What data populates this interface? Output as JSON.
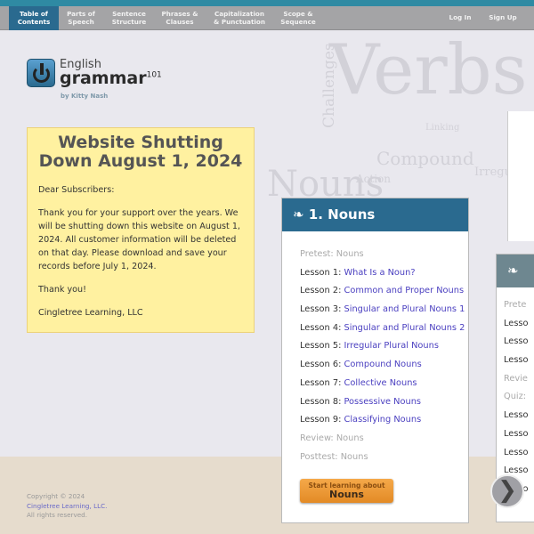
{
  "nav": {
    "tabs": [
      {
        "label": "Table of Contents",
        "active": true
      },
      {
        "label": "Parts of Speech"
      },
      {
        "label": "Sentence Structure"
      },
      {
        "label": "Phrases & Clauses"
      },
      {
        "label": "Capitalization & Punctuation"
      },
      {
        "label": "Scope & Sequence"
      }
    ],
    "login": "Log In",
    "signup": "Sign Up"
  },
  "logo": {
    "line1": "English",
    "line2": "grammar",
    "sup": "101",
    "byline": "by Kitty Nash",
    "icon": "power-icon"
  },
  "notice": {
    "title": "Website Shutting Down August 1, 2024",
    "greeting": "Dear Subscribers:",
    "body": "Thank you for your support over the years. We will be shutting down this website on August 1, 2024. All customer information will be deleted on that day. Please download and save your records before July 1, 2024.",
    "thanks": "Thank you!",
    "signature": "Cingletree Learning, LLC"
  },
  "card1": {
    "title": "1. Nouns",
    "icon": "swirl-icon",
    "items": [
      {
        "prefix": "Pretest: Nouns",
        "dim": true
      },
      {
        "prefix": "Lesson 1: ",
        "link": "What Is a Noun?"
      },
      {
        "prefix": "Lesson 2: ",
        "link": "Common and Proper Nouns"
      },
      {
        "prefix": "Lesson 3: ",
        "link": "Singular and Plural Nouns 1"
      },
      {
        "prefix": "Lesson 4: ",
        "link": "Singular and Plural Nouns 2"
      },
      {
        "prefix": "Lesson 5: ",
        "link": "Irregular Plural Nouns"
      },
      {
        "prefix": "Lesson 6: ",
        "link": "Compound Nouns"
      },
      {
        "prefix": "Lesson 7: ",
        "link": "Collective Nouns"
      },
      {
        "prefix": "Lesson 8: ",
        "link": "Possessive Nouns"
      },
      {
        "prefix": "Lesson 9: ",
        "link": "Classifying Nouns"
      },
      {
        "prefix": "Review: Nouns",
        "dim": true
      },
      {
        "prefix": "Posttest: Nouns",
        "dim": true
      }
    ],
    "button_line1": "Start learning about",
    "button_line2": "Nouns"
  },
  "card2": {
    "items": [
      {
        "text": "Prete",
        "dim": true
      },
      {
        "text": "Lesso"
      },
      {
        "text": "Lesso"
      },
      {
        "text": "Lesso"
      },
      {
        "text": "Revie",
        "dim": true
      },
      {
        "text": "Quiz:",
        "dim": true
      },
      {
        "text": "Lesso"
      },
      {
        "text": "Lesso"
      },
      {
        "text": "Lesso"
      },
      {
        "text": "Lesso"
      },
      {
        "text": "Lesso"
      }
    ]
  },
  "bgwords": [
    "Verbs",
    "Nouns",
    "Compound",
    "Irregular",
    "Challenges",
    "Action",
    "Linking"
  ],
  "footer": {
    "copyright": "Copyright © 2024",
    "company": "Cingletree Learning, LLC.",
    "rights": "All rights reserved."
  },
  "colors": {
    "nav_active": "#2a6a8f",
    "card_header": "#2a6a8f",
    "notice_bg": "#fff1a0",
    "button": "#ee9a35",
    "link": "#4a3fc0"
  }
}
